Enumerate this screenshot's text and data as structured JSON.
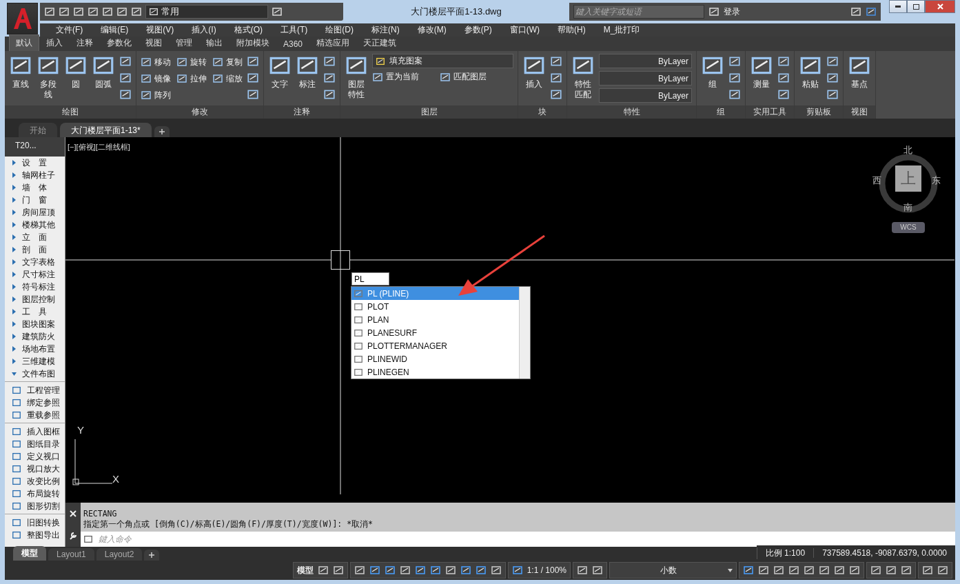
{
  "window": {
    "title": "大门楼层平面1-13.dwg",
    "workspace": "常用",
    "search": {
      "placeholder": "鍵入关键字或短语"
    },
    "login": "登录"
  },
  "menu": [
    "文件(F)",
    "编辑(E)",
    "视图(V)",
    "插入(I)",
    "格式(O)",
    "工具(T)",
    "绘图(D)",
    "标注(N)",
    "修改(M)",
    "参数(P)",
    "窗口(W)",
    "帮助(H)",
    "M_批打印"
  ],
  "ribbon_tabs": [
    {
      "label": "默认",
      "selected": true
    },
    {
      "label": "插入",
      "selected": false
    },
    {
      "label": "注释",
      "selected": false
    },
    {
      "label": "参数化",
      "selected": false
    },
    {
      "label": "视图",
      "selected": false
    },
    {
      "label": "管理",
      "selected": false
    },
    {
      "label": "输出",
      "selected": false
    },
    {
      "label": "附加模块",
      "selected": false
    },
    {
      "label": "A360",
      "selected": false
    },
    {
      "label": "精选应用",
      "selected": false
    },
    {
      "label": "天正建筑",
      "selected": false
    }
  ],
  "ribbon_panels": [
    {
      "title": "绘图",
      "tools": [
        {
          "kind": "large",
          "label": "直线"
        },
        {
          "kind": "large",
          "label": "多段线"
        },
        {
          "kind": "large",
          "label": "圆"
        },
        {
          "kind": "large",
          "label": "圆弧"
        },
        {
          "kind": "icons"
        }
      ]
    },
    {
      "title": "修改",
      "tools": [
        {
          "kind": "smallgrid",
          "items": [
            "移动",
            "旋转",
            "复制",
            "镜像",
            "拉伸",
            "缩放",
            "阵列"
          ]
        },
        {
          "kind": "icons"
        }
      ]
    },
    {
      "title": "注释",
      "tools": [
        {
          "kind": "large",
          "label": "文字"
        },
        {
          "kind": "large",
          "label": "标注"
        },
        {
          "kind": "icons"
        }
      ]
    },
    {
      "title": "图层",
      "tools": [
        {
          "kind": "large",
          "label": "图层特性"
        },
        {
          "kind": "layer",
          "value": "填充图案",
          "items": [
            "置为当前",
            "匹配图层"
          ]
        }
      ]
    },
    {
      "title": "块",
      "tools": [
        {
          "kind": "large",
          "label": "插入"
        },
        {
          "kind": "icons"
        }
      ]
    },
    {
      "title": "特性",
      "tools": [
        {
          "kind": "large",
          "label": "特性匹配"
        },
        {
          "kind": "dropdowns",
          "items": [
            "ByLayer",
            "ByLayer",
            "ByLayer"
          ]
        }
      ]
    },
    {
      "title": "组",
      "tools": [
        {
          "kind": "large",
          "label": "组"
        },
        {
          "kind": "icons"
        }
      ]
    },
    {
      "title": "实用工具",
      "tools": [
        {
          "kind": "large",
          "label": "测量"
        },
        {
          "kind": "icons"
        }
      ]
    },
    {
      "title": "剪贴板",
      "tools": [
        {
          "kind": "large",
          "label": "粘贴"
        },
        {
          "kind": "icons"
        }
      ]
    },
    {
      "title": "视图",
      "tools": [
        {
          "kind": "large",
          "label": "基点"
        }
      ]
    }
  ],
  "doc_tabs": [
    {
      "label": "开始",
      "selected": false
    },
    {
      "label": "大门楼层平面1-13*",
      "selected": true
    }
  ],
  "side_panel": {
    "title": "T20...",
    "items": [
      {
        "label": "设　置",
        "expanded": false
      },
      {
        "label": "轴网柱子",
        "expanded": false
      },
      {
        "label": "墙　体",
        "expanded": false
      },
      {
        "label": "门　窗",
        "expanded": false
      },
      {
        "label": "房间屋顶",
        "expanded": false
      },
      {
        "label": "楼梯其他",
        "expanded": false
      },
      {
        "label": "立　面",
        "expanded": false
      },
      {
        "label": "剖　面",
        "expanded": false
      },
      {
        "label": "文字表格",
        "expanded": false
      },
      {
        "label": "尺寸标注",
        "expanded": false
      },
      {
        "label": "符号标注",
        "expanded": false
      },
      {
        "label": "图层控制",
        "expanded": false
      },
      {
        "label": "工　具",
        "expanded": false
      },
      {
        "label": "图块图案",
        "expanded": false
      },
      {
        "label": "建筑防火",
        "expanded": false
      },
      {
        "label": "场地布置",
        "expanded": false
      },
      {
        "label": "三维建模",
        "expanded": false
      },
      {
        "label": "文件布图",
        "expanded": true
      }
    ],
    "tool_groups": [
      [
        "工程管理",
        "绑定参照",
        "重载参照"
      ],
      [
        "插入图框",
        "图纸目录",
        "定义视口",
        "视口放大",
        "改变比例",
        "布局旋转",
        "图形切割"
      ],
      [
        "旧图转换",
        "整图导出"
      ]
    ]
  },
  "viewport": {
    "label": "[−][俯视][二维线框]",
    "input": "PL",
    "compass": {
      "north": "北",
      "south": "南",
      "east": "东",
      "west": "西",
      "top": "上",
      "ucs": "WCS"
    },
    "axis": {
      "x": "X",
      "y": "Y"
    }
  },
  "autocomplete": [
    {
      "label": "PL (PLINE)",
      "selected": true
    },
    {
      "label": "PLOT",
      "selected": false
    },
    {
      "label": "PLAN",
      "selected": false
    },
    {
      "label": "PLANESURF",
      "selected": false
    },
    {
      "label": "PLOTTERMANAGER",
      "selected": false
    },
    {
      "label": "PLINEWID",
      "selected": false
    },
    {
      "label": "PLINEGEN",
      "selected": false
    }
  ],
  "command_line": {
    "history": [
      "RECTANG",
      "指定第一个角点或 [倒角(C)/标高(E)/圆角(F)/厚度(T)/宽度(W)]: *取消*"
    ],
    "placeholder": "鍵入命令"
  },
  "layout_tabs": [
    {
      "label": "模型",
      "selected": true
    },
    {
      "label": "Layout1",
      "selected": false
    },
    {
      "label": "Layout2",
      "selected": false
    }
  ],
  "status_bar": {
    "scale_readout": "比例 1:100",
    "coordinates": "737589.4518, -9087.6379, 0.0000",
    "model": "模型",
    "annotation_scale": "1:1 / 100%",
    "units": "小数"
  }
}
